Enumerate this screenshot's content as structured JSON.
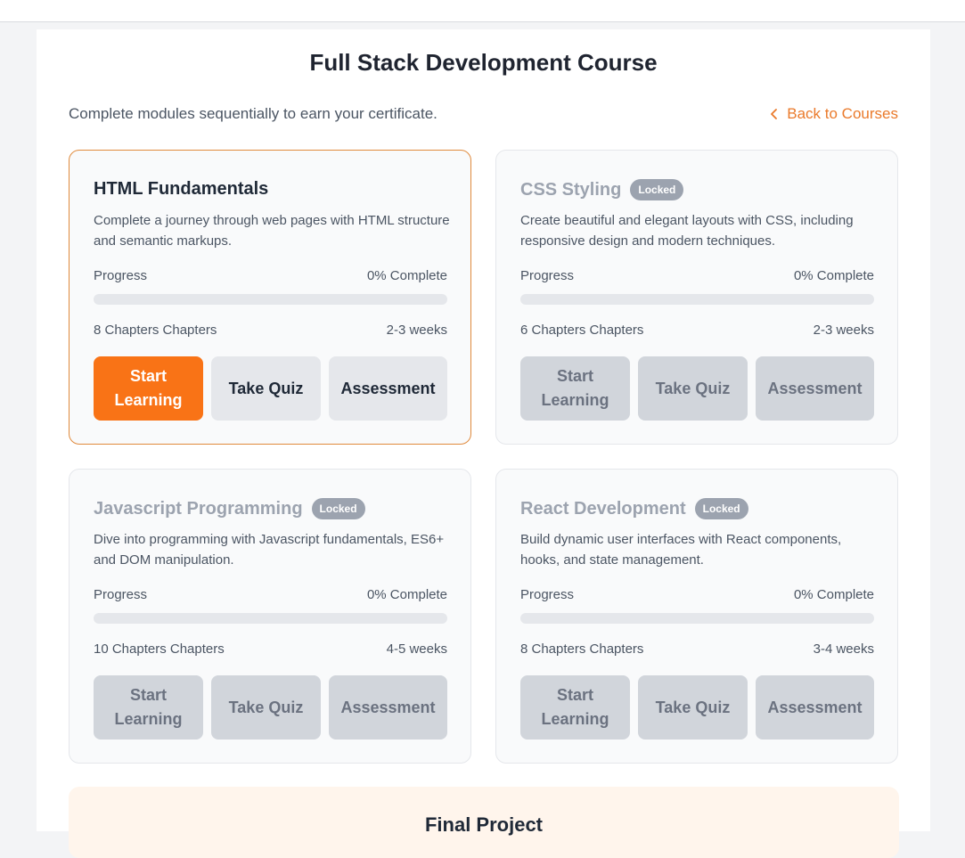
{
  "course": {
    "title": "Full Stack Development Course",
    "subtitle": "Complete modules sequentially to earn your certificate.",
    "back_label": "Back to Courses"
  },
  "labels": {
    "progress": "Progress",
    "locked": "Locked",
    "start": "Start Learning",
    "quiz": "Take Quiz",
    "assessment": "Assessment"
  },
  "modules": [
    {
      "title": "HTML Fundamentals",
      "description": "Complete a journey through web pages with HTML structure and semantic markups.",
      "progress_text": "0% Complete",
      "progress_value": 0,
      "chapters": "8 Chapters Chapters",
      "duration": "2-3 weeks",
      "locked": false
    },
    {
      "title": "CSS Styling",
      "description": "Create beautiful and elegant layouts with CSS, including responsive design and modern techniques.",
      "progress_text": "0% Complete",
      "progress_value": 0,
      "chapters": "6 Chapters Chapters",
      "duration": "2-3 weeks",
      "locked": true
    },
    {
      "title": "Javascript Programming",
      "description": "Dive into programming with Javascript fundamentals, ES6+ and DOM manipulation.",
      "progress_text": "0% Complete",
      "progress_value": 0,
      "chapters": "10 Chapters Chapters",
      "duration": "4-5 weeks",
      "locked": true
    },
    {
      "title": "React Development",
      "description": "Build dynamic user interfaces with React components, hooks, and state management.",
      "progress_text": "0% Complete",
      "progress_value": 0,
      "chapters": "8 Chapters Chapters",
      "duration": "3-4 weeks",
      "locked": true
    }
  ],
  "final": {
    "title": "Final Project"
  },
  "colors": {
    "accent": "#f97316",
    "link": "#ea7a2b",
    "locked_badge": "#9ca3af"
  }
}
